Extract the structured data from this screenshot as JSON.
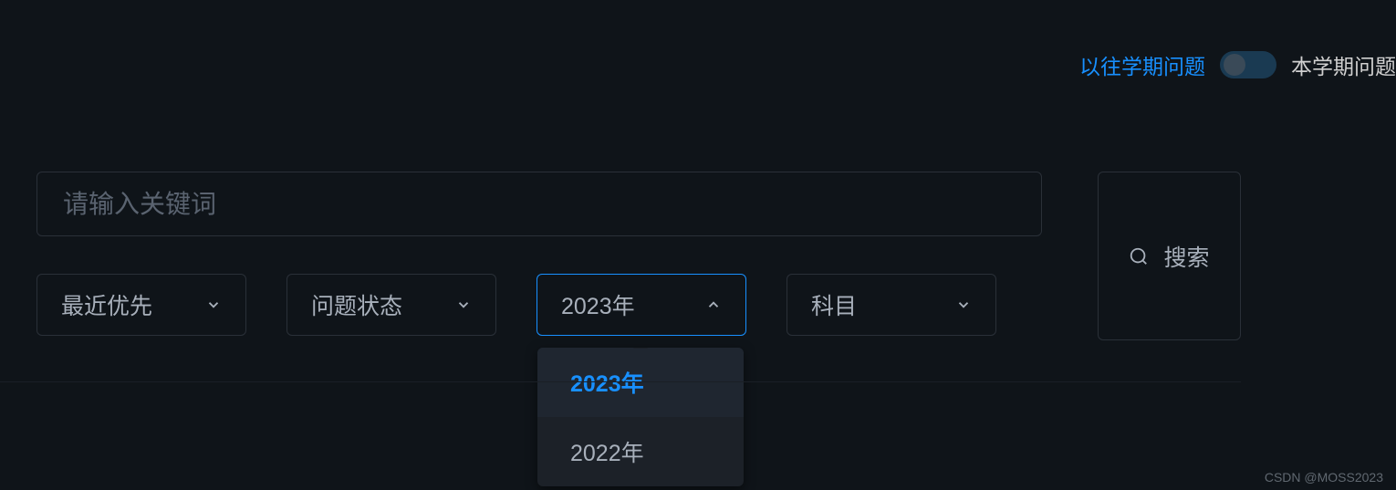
{
  "toggle": {
    "left_label": "以往学期问题",
    "right_label": "本学期问题"
  },
  "search": {
    "placeholder": "请输入关键词",
    "button_label": "搜索"
  },
  "filters": {
    "sort": {
      "label": "最近优先"
    },
    "status": {
      "label": "问题状态"
    },
    "year": {
      "label": "2023年",
      "options": [
        "2023年",
        "2022年"
      ],
      "selected": "2023年"
    },
    "subject": {
      "label": "科目"
    }
  },
  "watermark": "CSDN @MOSS2023"
}
